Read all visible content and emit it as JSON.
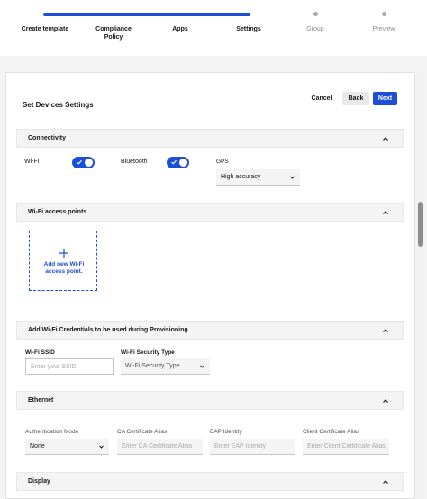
{
  "stepper": {
    "steps": [
      {
        "label": "Create template",
        "state": "complete"
      },
      {
        "label": "Compliance\nPolicy",
        "state": "complete"
      },
      {
        "label": "Apps",
        "state": "complete"
      },
      {
        "label": "Settings",
        "state": "current"
      },
      {
        "label": "Group",
        "state": "upcoming"
      },
      {
        "label": "Preview",
        "state": "upcoming"
      }
    ]
  },
  "header": {
    "title": "Set Devices Settings",
    "cancel_label": "Cancel",
    "back_label": "Back",
    "next_label": "Next"
  },
  "connectivity": {
    "section_label": "Connectivity",
    "wifi_label": "Wi-Fi",
    "wifi_on": true,
    "bluetooth_label": "Bluetooth",
    "bluetooth_on": true,
    "gps_label": "GPS",
    "gps_value": "High accuracy"
  },
  "access_points": {
    "section_label": "Wi-Fi access points",
    "add_label": "Add new Wi-Fi access point."
  },
  "wifi_credentials": {
    "section_label": "Add Wi-Fi Credentials to be used during Provisioning",
    "ssid_label": "Wi-Fi SSID",
    "ssid_placeholder": "Enter your SSID",
    "security_label": "Wi-Fi Security Type",
    "security_value": "Wi-Fi Security Type"
  },
  "ethernet": {
    "section_label": "Ethernet",
    "auth_mode_label": "Authentication Mode",
    "auth_mode_value": "None",
    "ca_alias_label": "CA Certificate Alias",
    "ca_alias_placeholder": "Enter CA Certificate Alias",
    "eap_label": "EAP Identity",
    "eap_placeholder": "Enter EAP Identity",
    "client_alias_label": "Client Certificate Alias",
    "client_alias_placeholder": "Enter Client Certificate Alias"
  },
  "display": {
    "section_label": "Display"
  },
  "colors": {
    "accent": "#1d4ed8",
    "section_bg": "#f4f4f4"
  }
}
